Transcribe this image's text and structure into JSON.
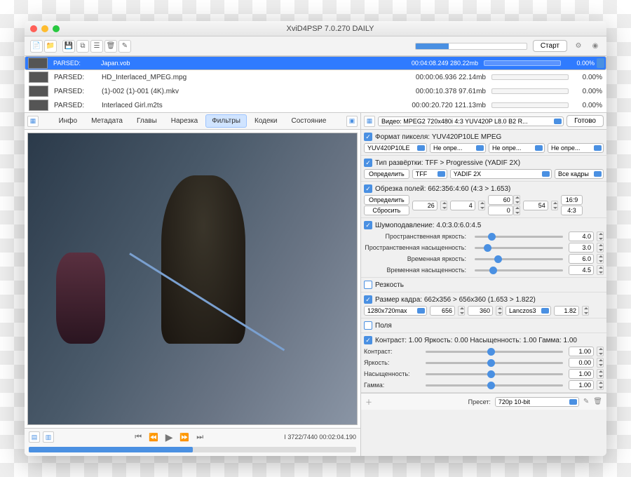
{
  "title": "XviD4PSP 7.0.270 DAILY",
  "toolbar": {
    "start_btn": "Старт"
  },
  "files": [
    {
      "status": "PARSED:",
      "name": "Japan.vob",
      "time": "00:04:08.249 280.22mb",
      "pc": "0.00%",
      "sel": true
    },
    {
      "status": "PARSED:",
      "name": "HD_Interlaced_MPEG.mpg",
      "time": "00:00:06.936 22.14mb",
      "pc": "0.00%",
      "sel": false
    },
    {
      "status": "PARSED:",
      "name": "(1)-002 (1)-001 (4K).mkv",
      "time": "00:00:10.378 97.61mb",
      "pc": "0.00%",
      "sel": false
    },
    {
      "status": "PARSED:",
      "name": "Interlaced Girl.m2ts",
      "time": "00:00:20.720 121.13mb",
      "pc": "0.00%",
      "sel": false
    }
  ],
  "tabs": [
    "Инфо",
    "Метадата",
    "Главы",
    "Нарезка",
    "Фильтры",
    "Кодеки",
    "Состояние"
  ],
  "active_tab": 4,
  "player_info": "I 3722/7440 00:02:04.190",
  "video_sel": "Видео: MPEG2 720x480i 4:3 YUV420P L8.0 B2 R...",
  "ready_btn": "Готово",
  "pixfmt": {
    "title": "Формат пикселя: YUV420P10LE MPEG",
    "v": "YUV420P10LE",
    "o": "Не опре..."
  },
  "scan": {
    "title": "Тип развёртки: TFF > Progressive (YADIF 2X)",
    "a": "Определить",
    "b": "TFF",
    "c": "YADIF 2X",
    "d": "Все кадры"
  },
  "crop": {
    "title": "Обрезка полей: 662:356:4:60 (4:3 > 1.653)",
    "det": "Определить",
    "reset": "Сбросить",
    "v1": "26",
    "v2": "4",
    "v3": "60",
    "v4": "54",
    "r1": "16:9",
    "r2": "4:3"
  },
  "denoise": {
    "title": "Шумоподавление: 4.0:3.0:6.0:4.5",
    "rows": [
      {
        "l": "Пространственная яркость:",
        "v": "4.0"
      },
      {
        "l": "Пространственная насыщенность:",
        "v": "3.0"
      },
      {
        "l": "Временная яркость:",
        "v": "6.0"
      },
      {
        "l": "Временная насыщенность:",
        "v": "4.5"
      }
    ]
  },
  "sharp": {
    "title": "Резкость"
  },
  "resize": {
    "title": "Размер кадра: 662x356 > 656x360 (1.653 > 1.822)",
    "preset": "1280x720max",
    "w": "656",
    "h": "360",
    "algo": "Lanczos3",
    "sc": "1.82"
  },
  "fields": {
    "title": "Поля"
  },
  "color": {
    "title": "Контраст: 1.00 Яркость: 0.00 Насыщенность: 1.00 Гамма: 1.00",
    "rows": [
      {
        "l": "Контраст:",
        "v": "1.00"
      },
      {
        "l": "Яркость:",
        "v": "0.00"
      },
      {
        "l": "Насыщенность:",
        "v": "1.00"
      },
      {
        "l": "Гамма:",
        "v": "1.00"
      }
    ]
  },
  "footer": {
    "preset_l": "Пресет:",
    "preset_v": "720p 10-bit"
  }
}
